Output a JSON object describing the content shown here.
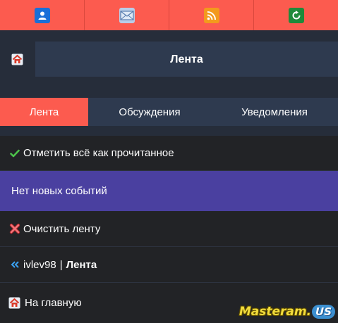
{
  "toolbar": {
    "buttons": [
      {
        "icon": "user-icon",
        "color": "#1a6fd8"
      },
      {
        "icon": "mail-icon",
        "color": "#b9cde8"
      },
      {
        "icon": "rss-icon",
        "color": "#f39a1d"
      },
      {
        "icon": "refresh-icon",
        "color": "#1f8a3a"
      }
    ]
  },
  "header": {
    "title": "Лента",
    "home_icon": "home-icon"
  },
  "tabs": [
    {
      "label": "Лента",
      "active": true
    },
    {
      "label": "Обсуждения",
      "active": false
    },
    {
      "label": "Уведомления",
      "active": false
    }
  ],
  "list": {
    "mark_all": {
      "icon": "check-icon",
      "label": "Отметить всё как прочитанное"
    },
    "empty_message": "Нет новых событий",
    "clear": {
      "icon": "delete-icon",
      "label": "Очистить ленту"
    },
    "breadcrumb": {
      "icon": "back-icon",
      "user": "ivlev98",
      "separator": "|",
      "current": "Лента"
    },
    "home": {
      "icon": "home-icon",
      "label": "На главную"
    }
  },
  "watermark": {
    "text": "Masteram.",
    "suffix": "US"
  },
  "colors": {
    "accent": "#fc5b4f",
    "header_bg": "#2e3a4f",
    "empty_bg": "#4a40a0",
    "row_bg": "#222326"
  }
}
